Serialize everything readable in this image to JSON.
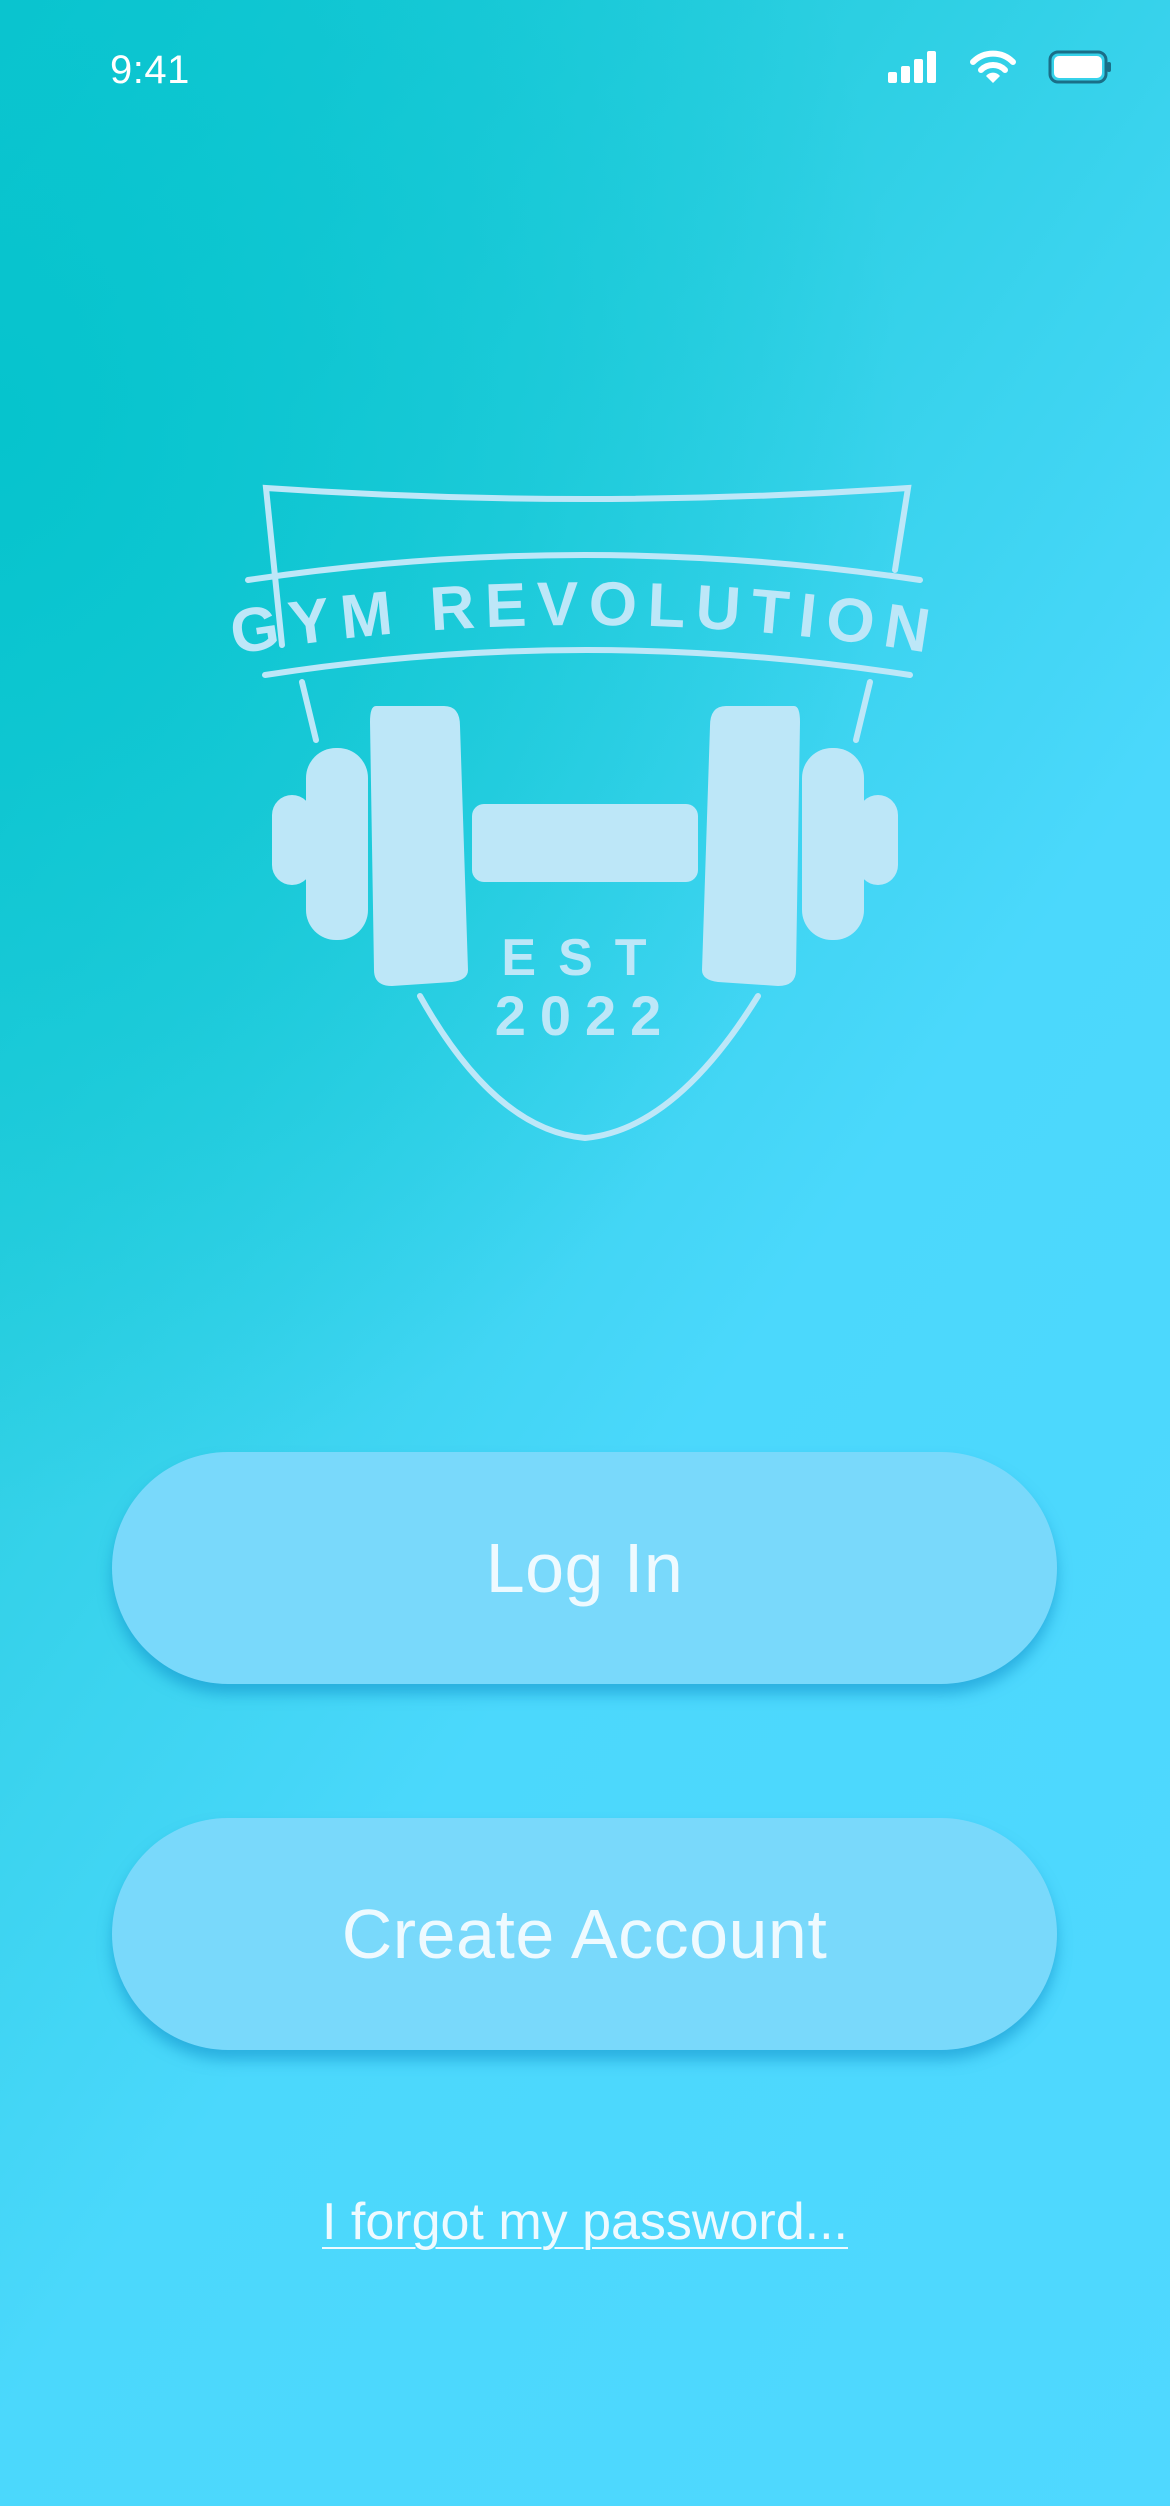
{
  "status_bar": {
    "time": "9:41",
    "icons": [
      "cellular-signal-icon",
      "wifi-icon",
      "battery-icon"
    ]
  },
  "logo": {
    "title": "GYM REVOLUTION",
    "est": "EST",
    "year": "2022",
    "icon": "dumbbell-icon",
    "color": "#bde7f8"
  },
  "actions": {
    "login_label": "Log In",
    "create_label": "Create Account",
    "forgot_label": "I forgot my password..."
  },
  "colors": {
    "background_start": "#06c4cd",
    "background_end": "#4fd8ff",
    "button_fill": "#79d9fb",
    "button_text": "#eefaff"
  }
}
